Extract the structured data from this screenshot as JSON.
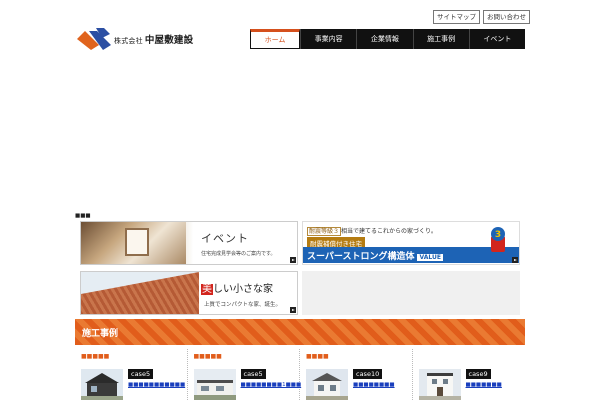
{
  "utility_nav": {
    "sitemap": "サイトマップ",
    "contact": "お問い合わせ"
  },
  "logo": {
    "prefix": "株式会社",
    "name": "中屋敷建設"
  },
  "global_nav": {
    "items": [
      {
        "label": "ホーム",
        "active": true
      },
      {
        "label": "事業内容",
        "active": false
      },
      {
        "label": "企業情報",
        "active": false
      },
      {
        "label": "施工事例",
        "active": false
      },
      {
        "label": "イベント",
        "active": false
      }
    ]
  },
  "tiny_label": "■■■",
  "banners": {
    "event": {
      "title": "イベント",
      "subtitle": "住宅完成見学会等のご案内です。"
    },
    "super_strong": {
      "phrase_boxed": "耐震等級３",
      "phrase_rest": "相当で建てるこれからの家づくり。",
      "seismic_label": "耐震補償付き住宅",
      "main_label": "スーパーストロング構造体",
      "value_label": "VALUE",
      "mascot_number": "3"
    },
    "small_house": {
      "title_first": "美",
      "title_rest": "しい小さな家",
      "subtitle": "上質でコンパクトな家、誕生。"
    }
  },
  "works": {
    "heading": "施工事例",
    "items": [
      {
        "category": "■■■■■",
        "case": "case5",
        "link": "■■■■■■■■■■■"
      },
      {
        "category": "■■■■■",
        "case": "case5",
        "link": "■■■■■■■■1■■■"
      },
      {
        "category": "■■■■",
        "case": "case10",
        "link": "■■■■■■■■"
      },
      {
        "category": "",
        "case": "case9",
        "link": "■■■■■■■"
      }
    ]
  },
  "colors": {
    "accent": "#e15d1b",
    "nav_bg": "#111111",
    "link": "#1a3fbd",
    "logo_blue": "#2c4fa3",
    "logo_orange": "#e0641e"
  },
  "icons": {
    "logo": "company-logo-mark",
    "corner": "arrow-corner-icon",
    "mascot": "structure-mascot"
  }
}
